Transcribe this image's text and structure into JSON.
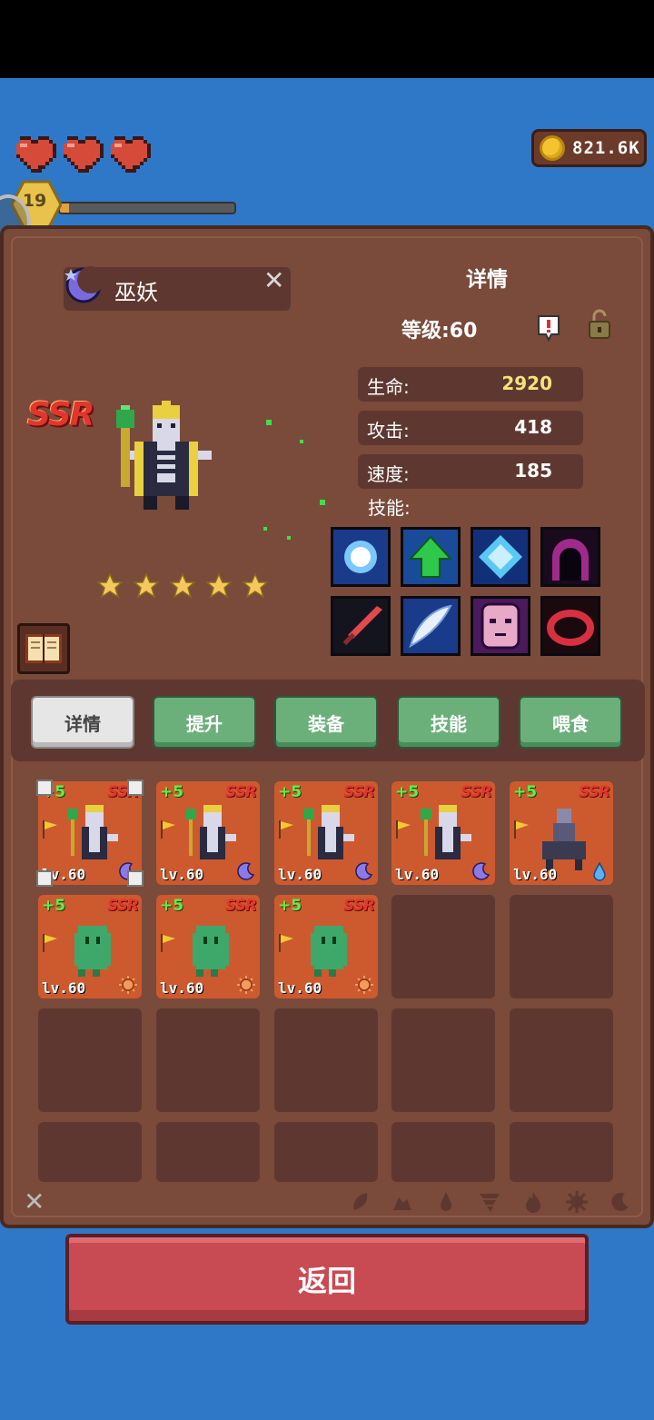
{
  "header": {
    "gold": "821.6K",
    "player_level": "19",
    "xp_fraction": 0.05,
    "hearts": 3
  },
  "hero": {
    "name": "巫妖",
    "rarity": "SSR",
    "stars": 5,
    "element": "moon"
  },
  "details": {
    "title": "详情",
    "level_label": "等级:60",
    "stats": [
      {
        "label": "生命:",
        "value": "2920"
      },
      {
        "label": "攻击:",
        "value": "418"
      },
      {
        "label": "速度:",
        "value": "185"
      }
    ],
    "skills_label": "技能:",
    "skills": [
      "light-orb-icon",
      "green-up-arrow-icon",
      "ice-crystal-icon",
      "dark-hood-icon",
      "red-sword-icon",
      "white-feather-icon",
      "pink-mask-icon",
      "red-ring-icon"
    ]
  },
  "tabs": [
    {
      "label": "详情",
      "active": true
    },
    {
      "label": "提升",
      "active": false
    },
    {
      "label": "装备",
      "active": false
    },
    {
      "label": "技能",
      "active": false
    },
    {
      "label": "喂食",
      "active": false
    }
  ],
  "inventory": [
    {
      "plus": "+5",
      "rarity": "SSR",
      "level": "lv.60",
      "hero": "lich",
      "element": "moon",
      "selected": true
    },
    {
      "plus": "+5",
      "rarity": "SSR",
      "level": "lv.60",
      "hero": "lich",
      "element": "moon",
      "selected": false
    },
    {
      "plus": "+5",
      "rarity": "SSR",
      "level": "lv.60",
      "hero": "lich",
      "element": "moon",
      "selected": false
    },
    {
      "plus": "+5",
      "rarity": "SSR",
      "level": "lv.60",
      "hero": "lich",
      "element": "moon",
      "selected": false
    },
    {
      "plus": "+5",
      "rarity": "SSR",
      "level": "lv.60",
      "hero": "shadow-rider",
      "element": "water",
      "selected": false
    },
    {
      "plus": "+5",
      "rarity": "SSR",
      "level": "lv.60",
      "hero": "green-ghost",
      "element": "sun",
      "selected": false
    },
    {
      "plus": "+5",
      "rarity": "SSR",
      "level": "lv.60",
      "hero": "green-ghost",
      "element": "sun",
      "selected": false
    },
    {
      "plus": "+5",
      "rarity": "SSR",
      "level": "lv.60",
      "hero": "green-ghost",
      "element": "sun",
      "selected": false
    }
  ],
  "filters": [
    "leaf-icon",
    "earth-icon",
    "water-drop-icon",
    "tornado-icon",
    "fire-icon",
    "sun-icon",
    "moon-icon"
  ],
  "back_label": "返回",
  "colors": {
    "background": "#2f78c8",
    "panel": "#7a4a3a",
    "tab_green": "#6bb07a",
    "back_button": "#c84a52",
    "card": "#cc5a2e"
  }
}
